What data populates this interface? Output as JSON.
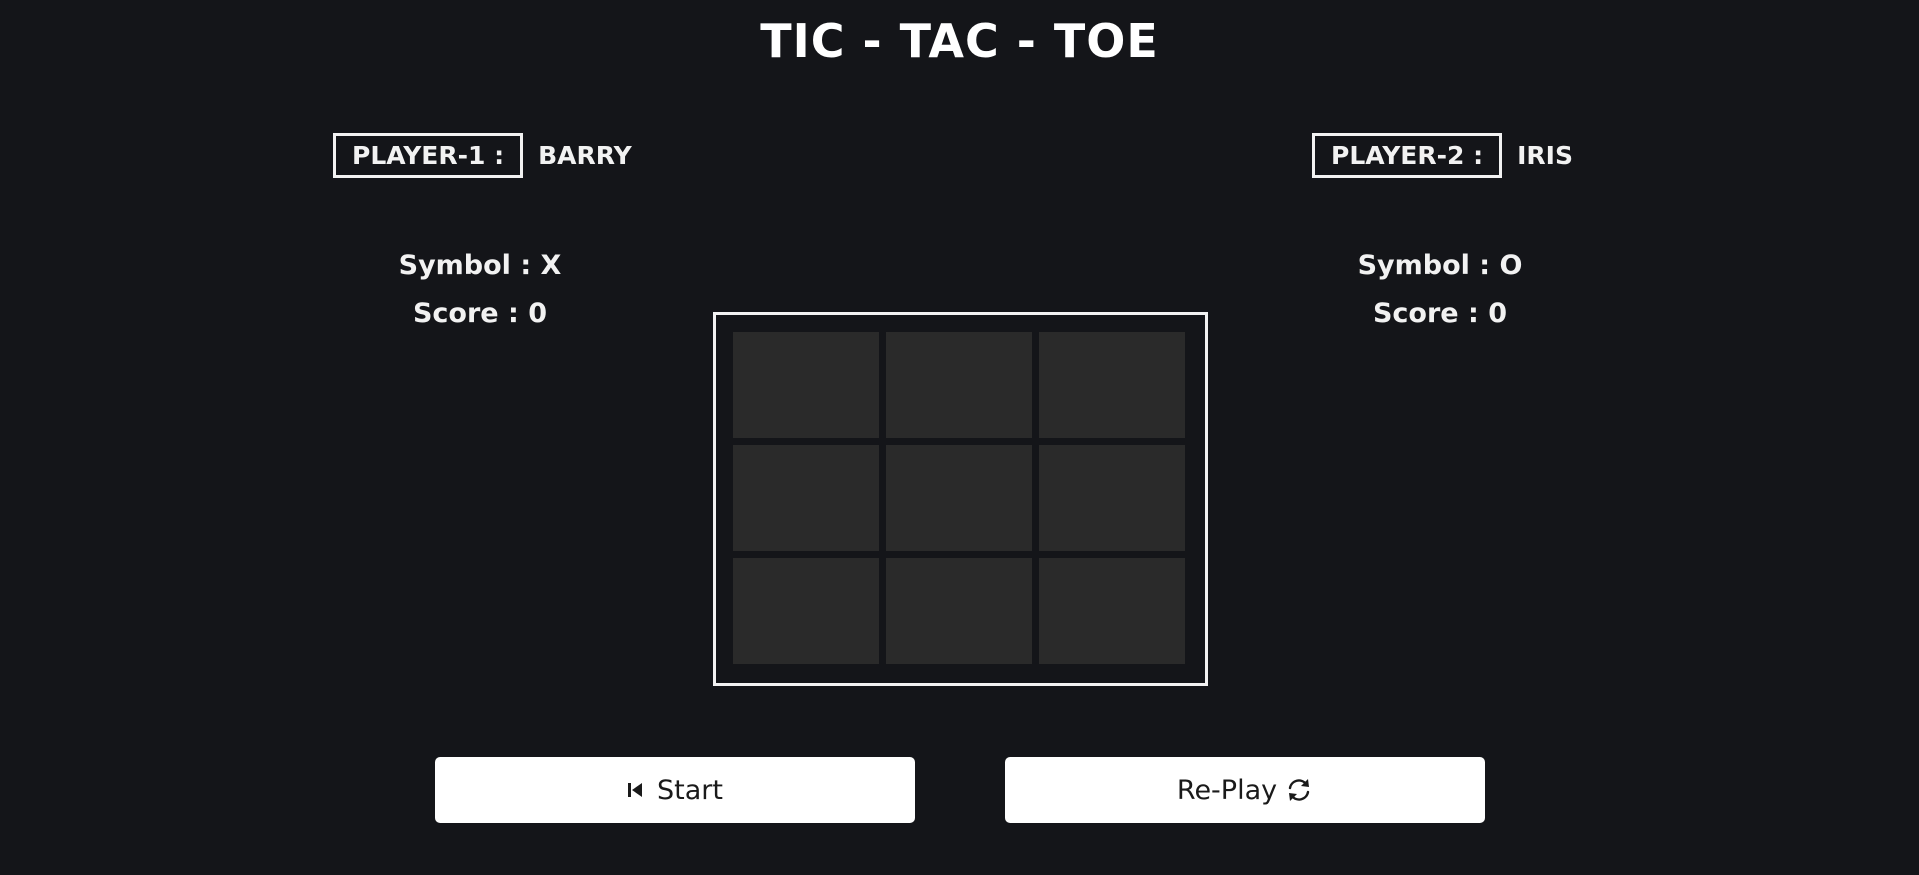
{
  "title": "TIC - TAC - TOE",
  "players": [
    {
      "label": "PLAYER-1 :",
      "name": "BARRY",
      "symbol_text": "Symbol : X",
      "score_text": "Score : 0"
    },
    {
      "label": "PLAYER-2 :",
      "name": "IRIS",
      "symbol_text": "Symbol : O",
      "score_text": "Score : 0"
    }
  ],
  "board": {
    "cells": [
      "",
      "",
      "",
      "",
      "",
      "",
      "",
      "",
      ""
    ]
  },
  "buttons": {
    "start_label": "Start",
    "start_icon": "skip-back-icon",
    "replay_label": "Re-Play",
    "replay_icon": "refresh-icon"
  },
  "colors": {
    "background": "#141519",
    "cell": "#2a2a2a",
    "text": "#f2f2f2",
    "button": "#ffffff"
  }
}
